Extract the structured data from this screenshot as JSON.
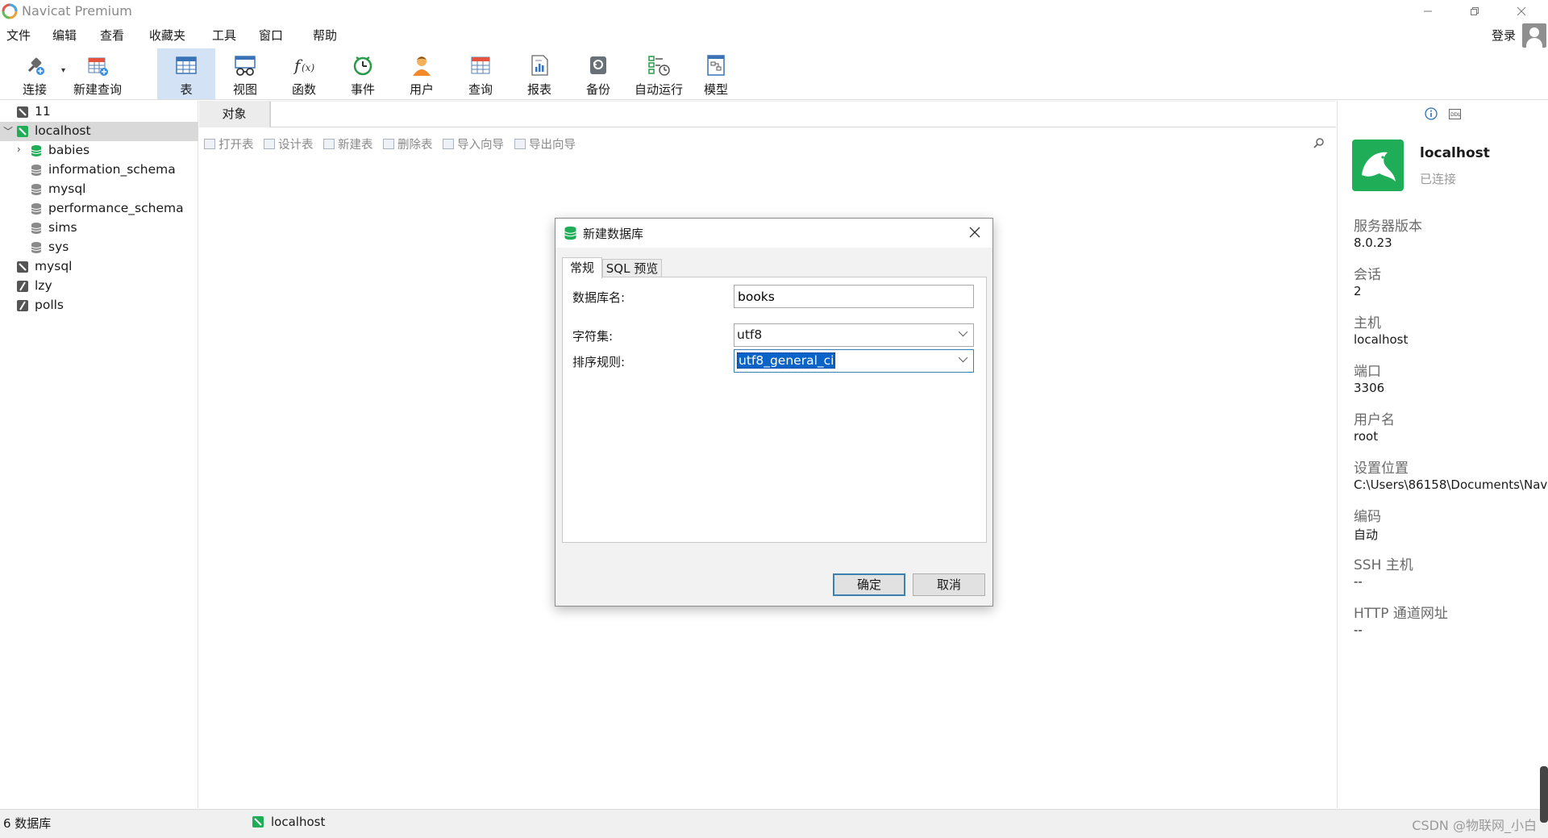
{
  "app": {
    "title": "Navicat Premium"
  },
  "menu": [
    "文件",
    "编辑",
    "查看",
    "收藏夹",
    "工具",
    "窗口",
    "帮助"
  ],
  "account": {
    "login_label": "登录"
  },
  "toolbar": {
    "connect": "连接",
    "new_query": "新建查询",
    "table": "表",
    "view": "视图",
    "function": "函数",
    "event": "事件",
    "user": "用户",
    "query": "查询",
    "report": "报表",
    "backup": "备份",
    "automation": "自动运行",
    "model": "模型"
  },
  "nav": {
    "items": [
      {
        "label": "11"
      },
      {
        "label": "localhost"
      },
      {
        "label": "babies"
      },
      {
        "label": "information_schema"
      },
      {
        "label": "mysql"
      },
      {
        "label": "performance_schema"
      },
      {
        "label": "sims"
      },
      {
        "label": "sys"
      },
      {
        "label": "mysql"
      },
      {
        "label": "lzy"
      },
      {
        "label": "polls"
      }
    ]
  },
  "objects": {
    "tab_label": "对象",
    "actions": [
      "打开表",
      "设计表",
      "新建表",
      "删除表",
      "导入向导",
      "导出向导"
    ]
  },
  "info_panel": {
    "connection_name": "localhost",
    "connection_status": "已连接",
    "fields": [
      {
        "label": "服务器版本",
        "value": "8.0.23"
      },
      {
        "label": "会话",
        "value": "2"
      },
      {
        "label": "主机",
        "value": "localhost"
      },
      {
        "label": "端口",
        "value": "3306"
      },
      {
        "label": "用户名",
        "value": "root"
      },
      {
        "label": "设置位置",
        "value": "C:\\Users\\86158\\Documents\\Nav"
      },
      {
        "label": "编码",
        "value": "自动"
      },
      {
        "label": "SSH 主机",
        "value": "--"
      },
      {
        "label": "HTTP 通道网址",
        "value": "--"
      }
    ]
  },
  "dialog": {
    "title": "新建数据库",
    "tabs": [
      "常规",
      "SQL 预览"
    ],
    "fields": {
      "db_name_label": "数据库名:",
      "db_name_value": "books",
      "charset_label": "字符集:",
      "charset_value": "utf8",
      "collation_label": "排序规则:",
      "collation_value": "utf8_general_ci"
    },
    "ok_label": "确定",
    "cancel_label": "取消"
  },
  "status": {
    "db_count": "6 数据库",
    "connection": "localhost",
    "watermark": "CSDN @物联网_小白"
  },
  "colors": {
    "brand_green": "#1fae57",
    "selection_blue": "#0a64c8",
    "active_tool_bg": "#d3e3f5"
  }
}
